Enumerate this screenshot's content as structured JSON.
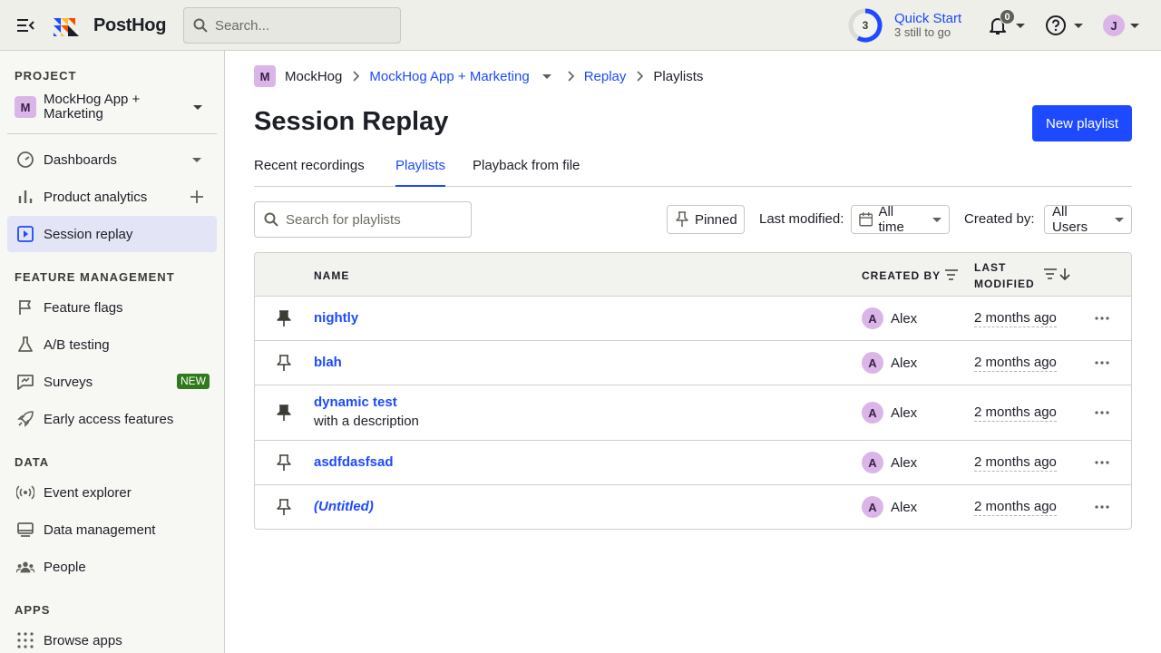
{
  "topbar": {
    "logo_text": "PostHog",
    "search_placeholder": "Search...",
    "quick_start": {
      "count": "3",
      "title": "Quick Start",
      "subtitle": "3 still to go"
    },
    "notifications_count": "0",
    "user_initial": "J"
  },
  "sidebar": {
    "project_heading": "PROJECT",
    "project_initial": "M",
    "project_name": "MockHog App + Marketing",
    "items": [
      {
        "label": "Dashboards",
        "icon": "dashboard-gauge-icon"
      },
      {
        "label": "Product analytics",
        "icon": "bar-chart-icon"
      },
      {
        "label": "Session replay",
        "icon": "play-square-icon"
      }
    ],
    "feature_heading": "FEATURE MANAGEMENT",
    "feature_items": [
      {
        "label": "Feature flags",
        "icon": "flag-icon"
      },
      {
        "label": "A/B testing",
        "icon": "flask-icon"
      },
      {
        "label": "Surveys",
        "icon": "survey-icon",
        "badge": "NEW"
      },
      {
        "label": "Early access features",
        "icon": "rocket-icon"
      }
    ],
    "data_heading": "DATA",
    "data_items": [
      {
        "label": "Event explorer",
        "icon": "broadcast-icon"
      },
      {
        "label": "Data management",
        "icon": "database-icon"
      },
      {
        "label": "People",
        "icon": "people-icon"
      }
    ],
    "apps_heading": "APPS",
    "apps_items": [
      {
        "label": "Browse apps",
        "icon": "grid-dots-icon"
      }
    ]
  },
  "breadcrumb": {
    "org_initial": "M",
    "org": "MockHog",
    "project": "MockHog App + Marketing",
    "section": "Replay",
    "current": "Playlists"
  },
  "page": {
    "title": "Session Replay",
    "new_playlist_label": "New playlist",
    "tabs": [
      "Recent recordings",
      "Playlists",
      "Playback from file"
    ],
    "active_tab": "Playlists"
  },
  "filters": {
    "search_placeholder": "Search for playlists",
    "pinned_label": "Pinned",
    "last_modified_label": "Last modified:",
    "last_modified_value": "All time",
    "created_by_label": "Created by:",
    "created_by_value": "All Users"
  },
  "table": {
    "columns": {
      "name": "NAME",
      "created_by": "CREATED BY",
      "last_modified_1": "LAST",
      "last_modified_2": "MODIFIED"
    },
    "rows": [
      {
        "name": "nightly",
        "description": "",
        "creator_initial": "A",
        "creator": "Alex",
        "modified": "2 months ago",
        "pinned": true
      },
      {
        "name": "blah",
        "description": "",
        "creator_initial": "A",
        "creator": "Alex",
        "modified": "2 months ago",
        "pinned": false
      },
      {
        "name": "dynamic test",
        "description": "with a description",
        "creator_initial": "A",
        "creator": "Alex",
        "modified": "2 months ago",
        "pinned": true
      },
      {
        "name": "asdfdasfsad",
        "description": "",
        "creator_initial": "A",
        "creator": "Alex",
        "modified": "2 months ago",
        "pinned": false
      },
      {
        "name": "(Untitled)",
        "description": "",
        "creator_initial": "A",
        "creator": "Alex",
        "modified": "2 months ago",
        "pinned": false
      }
    ]
  },
  "colors": {
    "accent": "#1d4aff",
    "avatar": "#dab5e8",
    "badge_new": "#317a1b",
    "active_nav": "#e3e5f6"
  }
}
